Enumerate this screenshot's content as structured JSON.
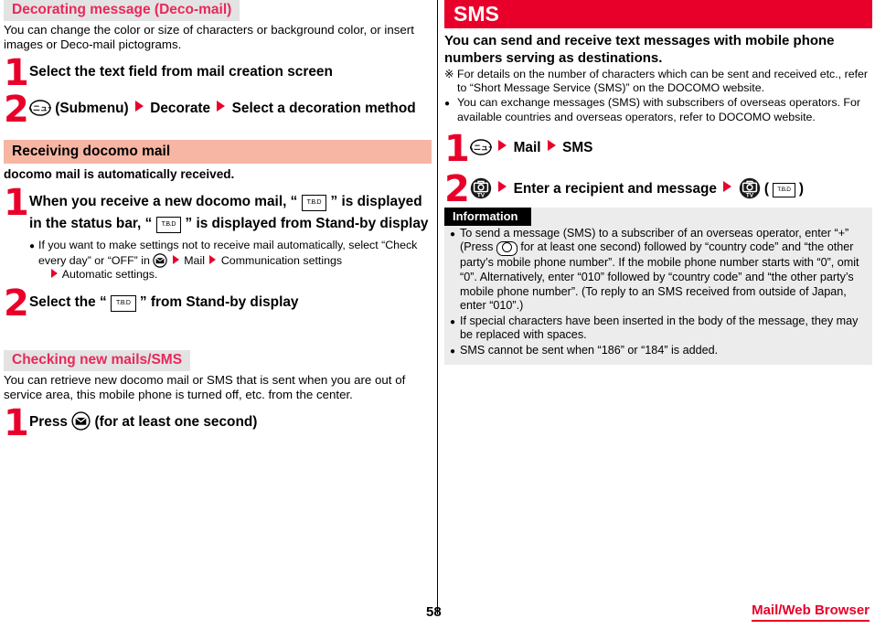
{
  "page": {
    "number": "58",
    "footer_title": "Mail/Web Browser"
  },
  "left_column": {
    "section_decomail": {
      "header": "Decorating message (Deco-mail)",
      "lead": "You can change the color or size of characters or background color, or insert images or Deco-mail pictograms.",
      "steps": [
        {
          "num": "1",
          "text": "Select the text field from mail creation screen"
        },
        {
          "num": "2",
          "icon": "menu-key-icon",
          "label_submenu": "(Submenu)",
          "part2": "Decorate",
          "part3": "Select a decoration method"
        }
      ]
    },
    "section_receiving": {
      "header": "Receiving docomo mail",
      "lead": "docomo mail is automatically received.",
      "steps": [
        {
          "num": "1",
          "text_a": "When you receive a new docomo mail, “",
          "icon_a": "T.B.D",
          "text_b": "” is displayed in the status bar, “",
          "icon_b": "T.B.D",
          "text_c": "” is displayed from Stand-by display",
          "note_a": "If you want to make settings not to receive mail automatically, select “Check every day” or “OFF” in",
          "note_b": "Mail",
          "note_c": "Communication settings",
          "note_d": "Automatic settings."
        },
        {
          "num": "2",
          "text_a": "Select the “",
          "icon_a": "T.B.D",
          "text_b": "” from Stand-by display"
        }
      ]
    },
    "section_checking": {
      "header": "Checking new mails/SMS",
      "lead": "You can retrieve new docomo mail or SMS that is sent when you are out of service area, this mobile phone is turned off, etc. from the center.",
      "steps": [
        {
          "num": "1",
          "text_a": "Press",
          "icon": "mail-key-icon",
          "text_b": "(for at least one second)"
        }
      ]
    }
  },
  "right_column": {
    "section_sms": {
      "header": "SMS",
      "lead": "You can send and receive text messages with mobile phone numbers serving as destinations.",
      "notes": [
        {
          "mark": "※",
          "text": "For details on the number of characters which can be sent and received etc., refer to “Short Message Service (SMS)” on the DOCOMO website."
        },
        {
          "mark": "●",
          "text": "You can exchange messages (SMS) with subscribers of overseas operators. For available countries and overseas operators, refer to DOCOMO website."
        }
      ],
      "steps": [
        {
          "num": "1",
          "icon": "menu-key-icon",
          "part1": "Mail",
          "part2": "SMS"
        },
        {
          "num": "2",
          "icon_a": "camera-tv-key-icon",
          "part1": "Enter a recipient and message",
          "icon_b": "camera-tv-key-icon",
          "paren_open": "(",
          "icon_c": "T.B.D",
          "paren_close": ")"
        }
      ]
    },
    "information": {
      "title": "Information",
      "items": [
        {
          "mark": "●",
          "text_a": "To send a message (SMS) to a subscriber of an overseas operator, enter “+” (Press",
          "key": "O",
          "text_b": "for at least one second) followed by “country code” and “the other party’s mobile phone number”. If the mobile phone number starts with “0”, omit “0”. Alternatively, enter “010” followed by “country code” and “the other party’s mobile phone number”. (To reply to an SMS received from outside of Japan, enter “010”.)"
        },
        {
          "mark": "●",
          "text_a": "If special characters have been inserted in the body of the message, they may be replaced with spaces."
        },
        {
          "mark": "●",
          "text_a": "SMS cannot be sent when “186” or “184” is added."
        }
      ]
    }
  },
  "colors": {
    "accent_red": "#e8002a",
    "header_pink": "#f7b5a4",
    "header_gray": "#e3e3e3",
    "info_bg": "#ececec"
  }
}
